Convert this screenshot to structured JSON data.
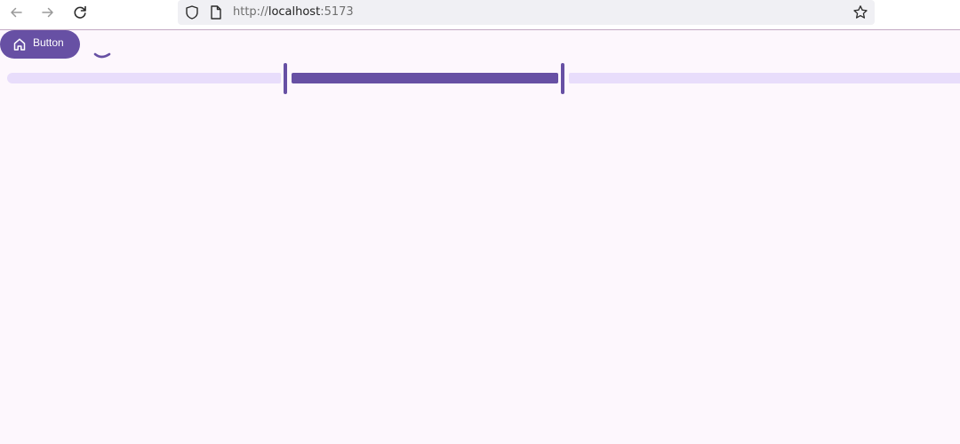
{
  "browser": {
    "url_scheme": "http://",
    "url_host": "localhost",
    "url_port": ":5173",
    "icons": [
      "arrow-left-icon",
      "arrow-right-icon",
      "reload-icon",
      "shield-icon",
      "page-icon",
      "star-icon"
    ]
  },
  "page": {
    "button": {
      "label": "Button",
      "icon": "home-icon"
    },
    "range_slider": {
      "min": 0,
      "max": 100,
      "start": 29,
      "end": 58
    },
    "colors": {
      "primary": "#6750a4",
      "track_inactive": "#e8ddfb",
      "background": "#fdf7fd"
    }
  }
}
